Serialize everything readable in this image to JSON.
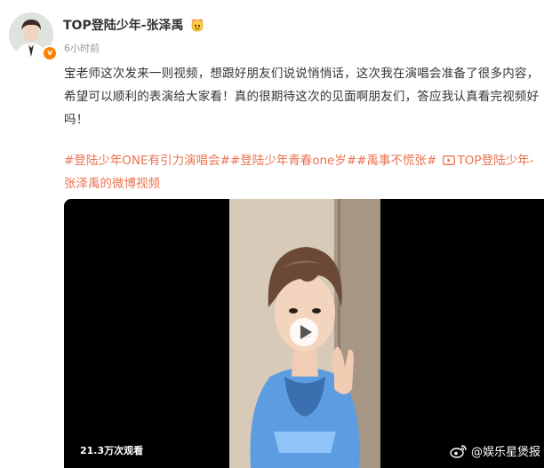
{
  "post": {
    "username": "TOP登陆少年-张泽禹",
    "time": "6小时前",
    "content": "宝老师这次发来一则视频，想跟好朋友们说说悄悄话，这次我在演唱会准备了很多内容，希望可以顺利的表演给大家看！真的很期待这次的见面啊朋友们，答应我认真看完视频好吗！",
    "tags": {
      "tag1": "#登陆少年ONE有引力演唱会#",
      "tag2": "#登陆少年青春one岁#",
      "tag3": "#禹事不慌张#",
      "video_link": "TOP登陆少年-张泽禹的微博视频"
    }
  },
  "video": {
    "views": "21.3万次观看",
    "watermark": "@娱乐星煲报"
  },
  "colors": {
    "link": "#eb7350",
    "verified": "#ff8200",
    "video_bg": "#000000"
  },
  "icons": [
    "verified-icon",
    "fan-badge-icon",
    "video-link-icon",
    "play-icon",
    "weibo-logo-icon"
  ]
}
